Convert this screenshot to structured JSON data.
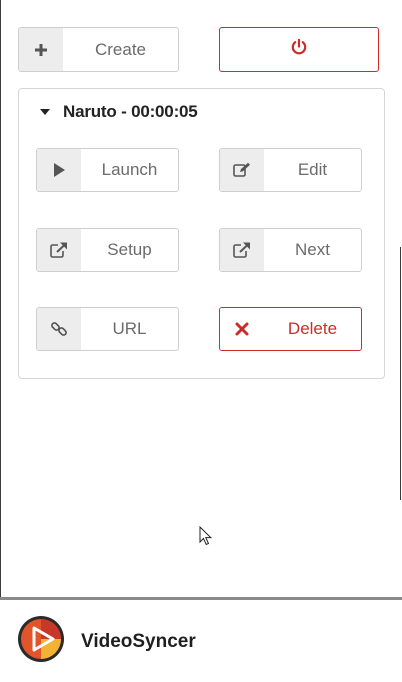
{
  "toolbar": {
    "create_label": "Create",
    "create_icon": "plus-icon",
    "power_icon": "power-icon"
  },
  "item": {
    "title": "Naruto - 00:00:05",
    "expanded": true,
    "actions": {
      "launch_label": "Launch",
      "edit_label": "Edit",
      "setup_label": "Setup",
      "next_label": "Next",
      "url_label": "URL",
      "delete_label": "Delete"
    }
  },
  "footer": {
    "app_name": "VideoSyncer"
  },
  "colors": {
    "danger": "#cc2b2b",
    "icon_bg": "#ededed",
    "border": "#cfcfcf",
    "muted_text": "#6b6b6b"
  }
}
